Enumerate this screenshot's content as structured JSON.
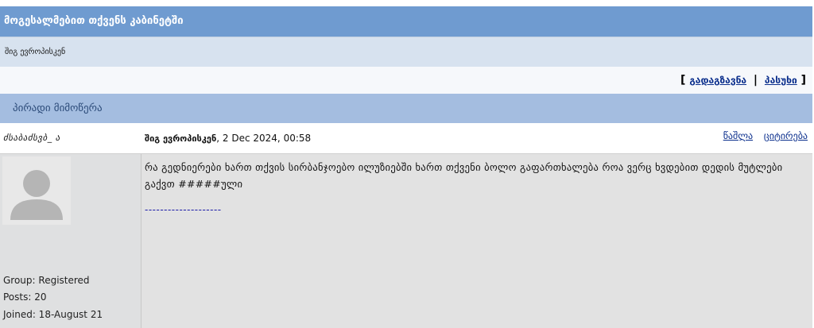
{
  "header": {
    "title": "მოგესალმებით თქვენს კაბინეტში",
    "user_name": "შიგ ევროპისკენ"
  },
  "actions": {
    "open_bracket": "[",
    "forward": "გადაგზავნა",
    "separator": "|",
    "reply": "პასუხი",
    "close_bracket": "]"
  },
  "section": {
    "title": "პირადი მიმოწერა"
  },
  "post": {
    "sender_signature": "ძსაბაძსვბ_ ა",
    "author": "შიგ ევროპისკენ",
    "date": ", 2 Dec 2024, 00:58",
    "delete_label": "წაშლა",
    "quote_label": "ციტირება",
    "message": "რა გედნიერები ხართ თქვის სირბანჯოებო ილუზიებში ხართ თქვენი ბოლო გაფართხალება როა ვერც ხვდებით დედის მუტლები გაქვთ #####ული",
    "signature_line": "--------------------"
  },
  "user": {
    "group": "Group: Registered",
    "posts": "Posts: 20",
    "joined": "Joined: 18-August 21"
  },
  "colors": {
    "title_bar": "#6f9bd0",
    "subtitle_bar": "#d7e2ef",
    "section_bar": "#a4bde0",
    "link": "#0a2e8c",
    "post_body": "#e2e2e2"
  }
}
